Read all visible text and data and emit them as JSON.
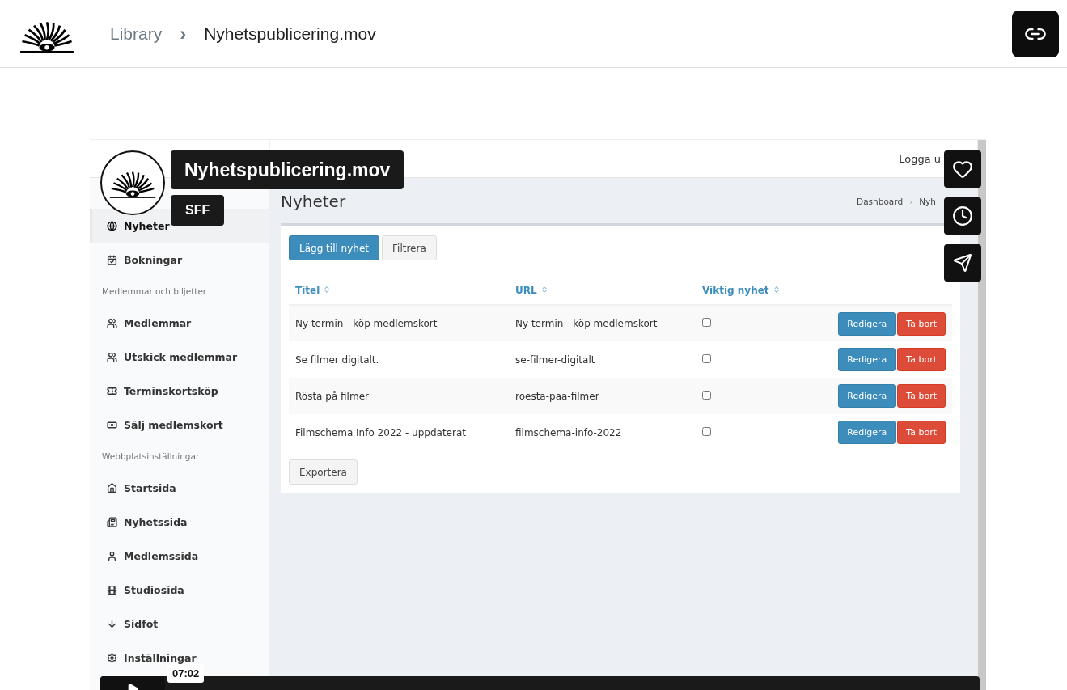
{
  "breadcrumb": {
    "parent": "Library",
    "separator": "›",
    "current": "Nyhetspublicering.mov"
  },
  "video": {
    "admin": {
      "logout": "Logga u",
      "sidebar": [
        {
          "kind": "item",
          "label": "Nyheter",
          "selected": true
        },
        {
          "kind": "item",
          "label": "Bokningar",
          "selected": false
        },
        {
          "kind": "section",
          "label": "Medlemmar och biljetter"
        },
        {
          "kind": "item",
          "label": "Medlemmar",
          "selected": false
        },
        {
          "kind": "item",
          "label": "Utskick medlemmar",
          "selected": false
        },
        {
          "kind": "item",
          "label": "Terminskortsköp",
          "selected": false
        },
        {
          "kind": "item",
          "label": "Sälj medlemskort",
          "selected": false
        },
        {
          "kind": "section",
          "label": "Webbplatsinställningar"
        },
        {
          "kind": "item",
          "label": "Startsida",
          "selected": false
        },
        {
          "kind": "item",
          "label": "Nyhetssida",
          "selected": false
        },
        {
          "kind": "item",
          "label": "Medlemssida",
          "selected": false
        },
        {
          "kind": "item",
          "label": "Studiosida",
          "selected": false
        },
        {
          "kind": "item",
          "label": "Sidfot",
          "selected": false
        },
        {
          "kind": "item",
          "label": "Inställningar",
          "selected": false
        }
      ],
      "page_title": "Nyheter",
      "crumbs": [
        "Dashboard",
        "›",
        "Nyh"
      ],
      "actions": [
        {
          "label": "Lägg till nyhet",
          "kind": "primary"
        },
        {
          "label": "Filtrera",
          "kind": "default"
        }
      ],
      "table": {
        "columns": [
          "Titel",
          "URL",
          "Viktig nyhet"
        ],
        "rows": [
          {
            "title": "Ny termin - köp medlemskort",
            "url": "Ny termin - köp medlemskort",
            "important": false,
            "buttons": [
              "Redigera",
              "Ta bort"
            ]
          },
          {
            "title": "Se filmer digitalt.",
            "url": "se-filmer-digitalt",
            "important": false,
            "buttons": [
              "Redigera",
              "Ta bort"
            ]
          },
          {
            "title": "Rösta på filmer",
            "url": "roesta-paa-filmer",
            "important": false,
            "buttons": [
              "Redigera",
              "Ta bort"
            ]
          },
          {
            "title": "Filmschema Info 2022 - uppdaterat",
            "url": "filmschema-info-2022",
            "important": false,
            "buttons": [
              "Redigera",
              "Ta bort"
            ]
          }
        ]
      },
      "export": "Exportera"
    },
    "overlay_title": "Nyhetspublicering.mov",
    "overlay_owner": "SFF",
    "time": "07:02"
  }
}
